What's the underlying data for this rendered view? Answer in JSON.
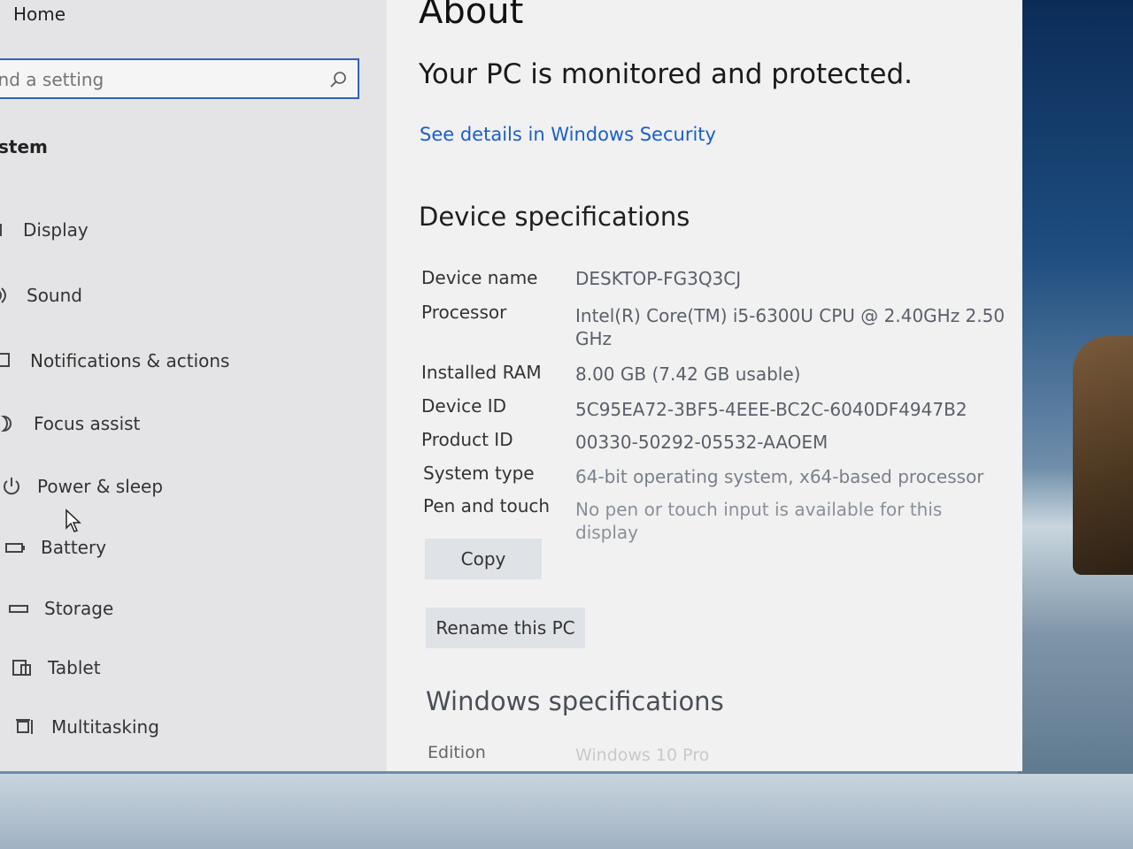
{
  "sidebar": {
    "home": "Home",
    "search_placeholder": "ind a setting",
    "section": "stem",
    "items": [
      {
        "label": "Display",
        "icon": "display-icon"
      },
      {
        "label": "Sound",
        "icon": "sound-icon"
      },
      {
        "label": "Notifications & actions",
        "icon": "notifications-icon"
      },
      {
        "label": "Focus assist",
        "icon": "focus-assist-icon"
      },
      {
        "label": "Power & sleep",
        "icon": "power-icon"
      },
      {
        "label": "Battery",
        "icon": "battery-icon"
      },
      {
        "label": "Storage",
        "icon": "storage-icon"
      },
      {
        "label": "Tablet",
        "icon": "tablet-icon"
      },
      {
        "label": "Multitasking",
        "icon": "multitasking-icon"
      }
    ]
  },
  "main": {
    "title": "About",
    "protected_text": "Your PC is monitored and protected.",
    "security_link": "See details in Windows Security",
    "device_heading": "Device specifications",
    "specs": [
      {
        "label": "Device name",
        "value": "DESKTOP-FG3Q3CJ"
      },
      {
        "label": "Processor",
        "value": "Intel(R) Core(TM) i5-6300U CPU @ 2.40GHz   2.50 GHz"
      },
      {
        "label": "Installed RAM",
        "value": "8.00 GB (7.42 GB usable)"
      },
      {
        "label": "Device ID",
        "value": "5C95EA72-3BF5-4EEE-BC2C-6040DF4947B2"
      },
      {
        "label": "Product ID",
        "value": "00330-50292-05532-AAOEM"
      },
      {
        "label": "System type",
        "value": "64-bit operating system, x64-based processor"
      },
      {
        "label": "Pen and touch",
        "value": "No pen or touch input is available for this display"
      }
    ],
    "copy_button": "Copy",
    "rename_button": "Rename this PC",
    "windows_heading": "Windows specifications",
    "edition_label": "Edition",
    "edition_value": "Windows 10 Pro"
  },
  "colors": {
    "accent": "#2f63b9",
    "link": "#1a5fc9"
  }
}
